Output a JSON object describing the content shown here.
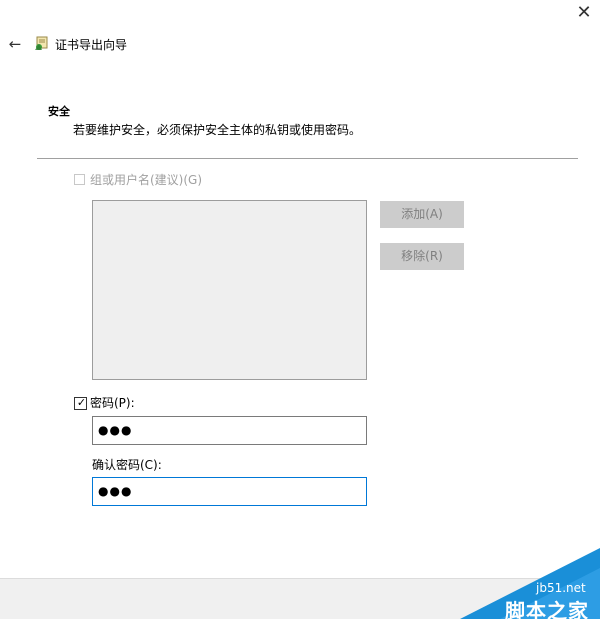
{
  "window": {
    "close_glyph": "✕",
    "back_glyph": "←",
    "title": "证书导出向导"
  },
  "section": {
    "title": "安全",
    "description": "若要维护安全，必须保护安全主体的私钥或使用密码。"
  },
  "group_option": {
    "label": "组或用户名(建议)(G)",
    "checked": false,
    "enabled": false
  },
  "buttons": {
    "add": "添加(A)",
    "remove": "移除(R)"
  },
  "password_option": {
    "label": "密码(P):",
    "checked": true,
    "check_glyph": "✓"
  },
  "password_field": {
    "value": "●●●"
  },
  "confirm_field": {
    "label": "确认密码(C):",
    "value": "●●●"
  },
  "watermark": {
    "site": "jb51.net",
    "brand": "脚本之家"
  },
  "colors": {
    "accent_focus_border": "#0078d7",
    "disabled_button_bg": "#cccccc",
    "watermark_blue": "#1a8fd8"
  },
  "icons": {
    "wizard": "certificate-wizard-icon",
    "close": "close-icon",
    "back": "back-arrow-icon"
  }
}
